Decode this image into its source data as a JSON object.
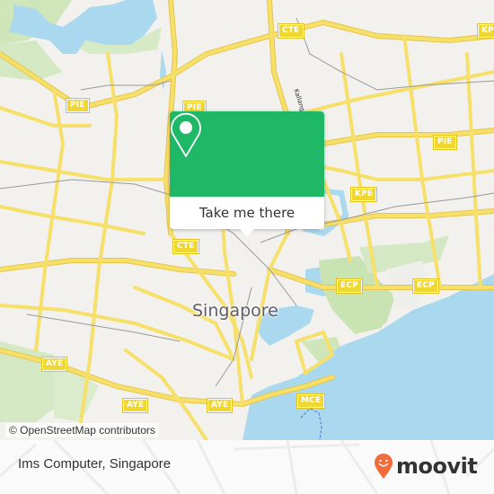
{
  "map": {
    "city_label": "Singapore",
    "street_label": "Kallang",
    "attribution": "© OpenStreetMap contributors",
    "highway_shields": [
      {
        "label": "CTE"
      },
      {
        "label": "PIE"
      },
      {
        "label": "PIE"
      },
      {
        "label": "KPE"
      },
      {
        "label": "PIE"
      },
      {
        "label": "KPE"
      },
      {
        "label": "CTE"
      },
      {
        "label": "ECP"
      },
      {
        "label": "ECP"
      },
      {
        "label": "AYE"
      },
      {
        "label": "AYE"
      },
      {
        "label": "AYE"
      },
      {
        "label": "MCE"
      }
    ],
    "colors": {
      "land": "#f2f1ee",
      "water": "#aadaef",
      "park": "#cde8b8",
      "road": "#f7e06a",
      "road_outline": "#e6c64a"
    }
  },
  "popup": {
    "pin_icon": "location-pin-icon",
    "button_label": "Take me there",
    "color": "#1eb867"
  },
  "footer": {
    "place_title": "Ims Computer, Singapore",
    "brand": "moovit",
    "brand_color": "#f26b3a"
  }
}
